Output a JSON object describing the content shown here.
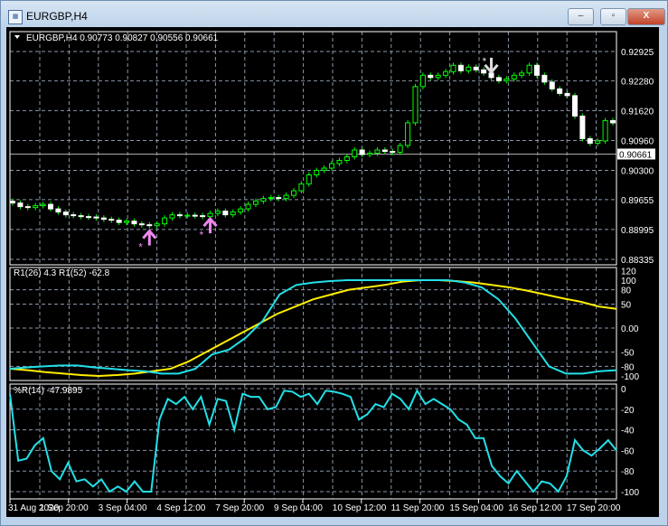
{
  "window": {
    "title": "EURGBP,H4",
    "minimize": "–",
    "restore": "▫",
    "close": "X"
  },
  "header": "EURGBP,H4  0.90773 0.90827 0.90556 0.90661",
  "price_labels": [
    {
      "v": 0.92925,
      "t": "0.92925"
    },
    {
      "v": 0.9228,
      "t": "0.92280"
    },
    {
      "v": 0.9162,
      "t": "0.91620"
    },
    {
      "v": 0.9096,
      "t": "0.90960"
    },
    {
      "v": 0.903,
      "t": "0.90300"
    },
    {
      "v": 0.89655,
      "t": "0.89655"
    },
    {
      "v": 0.88995,
      "t": "0.88995"
    },
    {
      "v": 0.88335,
      "t": "0.88335"
    }
  ],
  "current_price": {
    "v": 0.90661,
    "t": "0.90661"
  },
  "closes": [
    0.8958,
    0.895,
    0.8948,
    0.8952,
    0.8955,
    0.8945,
    0.8938,
    0.8932,
    0.893,
    0.8928,
    0.8927,
    0.8925,
    0.8922,
    0.892,
    0.8915,
    0.8918,
    0.8912,
    0.891,
    0.8908,
    0.8912,
    0.8925,
    0.8932,
    0.893,
    0.8931,
    0.893,
    0.8928,
    0.8935,
    0.894,
    0.8932,
    0.8938,
    0.8945,
    0.8955,
    0.8962,
    0.8968,
    0.897,
    0.8968,
    0.8975,
    0.8985,
    0.9,
    0.902,
    0.903,
    0.9035,
    0.9045,
    0.9052,
    0.906,
    0.9075,
    0.9065,
    0.9068,
    0.9075,
    0.9072,
    0.907,
    0.9085,
    0.9135,
    0.9215,
    0.924,
    0.9235,
    0.924,
    0.9248,
    0.9262,
    0.925,
    0.9258,
    0.9252,
    0.9245,
    0.9235,
    0.9228,
    0.9232,
    0.924,
    0.9245,
    0.9262,
    0.924,
    0.9225,
    0.921,
    0.92,
    0.9195,
    0.915,
    0.91,
    0.909,
    0.9095,
    0.914,
    0.9135
  ],
  "osc1": {
    "label": "R1(26) 4.3  R1(52) -62.8",
    "ticks": [
      {
        "v": 120,
        "t": "120"
      },
      {
        "v": 100,
        "t": "100"
      },
      {
        "v": 80,
        "t": "80"
      },
      {
        "v": 50,
        "t": "50"
      },
      {
        "v": 0,
        "t": "0.00"
      },
      {
        "v": -50,
        "t": "-50"
      },
      {
        "v": -80,
        "t": "-80"
      },
      {
        "v": -100,
        "t": "-100"
      }
    ],
    "r26": [
      -85,
      -82,
      -80,
      -78,
      -78,
      -82,
      -85,
      -88,
      -90,
      -95,
      -95,
      -85,
      -55,
      -45,
      -20,
      15,
      70,
      90,
      95,
      98,
      100,
      100,
      100,
      100,
      100,
      100,
      100,
      95,
      85,
      60,
      20,
      -30,
      -80,
      -95,
      -95,
      -90,
      -88
    ],
    "r52": [
      -85,
      -88,
      -92,
      -95,
      -98,
      -100,
      -98,
      -95,
      -90,
      -85,
      -70,
      -50,
      -30,
      -10,
      10,
      30,
      45,
      60,
      70,
      80,
      85,
      90,
      97,
      100,
      100,
      98,
      95,
      90,
      85,
      78,
      70,
      62,
      55,
      45,
      40
    ],
    "colors": {
      "r26": "#22e0e8",
      "r52": "#ffee00"
    }
  },
  "osc2": {
    "label": "%R(14) -47.9895",
    "ticks": [
      {
        "v": 0,
        "t": "0"
      },
      {
        "v": -20,
        "t": "-20"
      },
      {
        "v": -40,
        "t": "-40"
      },
      {
        "v": -60,
        "t": "-60"
      },
      {
        "v": -80,
        "t": "-80"
      },
      {
        "v": -100,
        "t": "-100"
      }
    ],
    "values": [
      -5,
      -70,
      -68,
      -55,
      -48,
      -80,
      -88,
      -72,
      -90,
      -88,
      -95,
      -88,
      -100,
      -95,
      -100,
      -90,
      -100,
      -100,
      -30,
      -10,
      -15,
      -8,
      -20,
      -8,
      -35,
      -10,
      -12,
      -40,
      -5,
      -8,
      -8,
      -20,
      -18,
      -2,
      -3,
      -8,
      -5,
      -15,
      -2,
      -3,
      -5,
      -8,
      -30,
      -25,
      -15,
      -18,
      -5,
      -10,
      -20,
      -2,
      -15,
      -10,
      -15,
      -20,
      -30,
      -35,
      -48,
      -48,
      -75,
      -85,
      -92,
      -80,
      -90,
      -100,
      -90,
      -92,
      -100,
      -85,
      -50,
      -60,
      -65,
      -58,
      -50,
      -60
    ]
  },
  "time_labels": [
    "31 Aug 2020",
    "1 Sep 20:00",
    "3 Sep 04:00",
    "4 Sep 12:00",
    "7 Sep 20:00",
    "9 Sep 04:00",
    "10 Sep 12:00",
    "11 Sep 20:00",
    "15 Sep 04:00",
    "16 Sep 12:00",
    "17 Sep 20:00"
  ],
  "signals": [
    {
      "type": "buy",
      "index": 18
    },
    {
      "type": "buy",
      "index": 26
    },
    {
      "type": "sell",
      "index": 63
    }
  ]
}
